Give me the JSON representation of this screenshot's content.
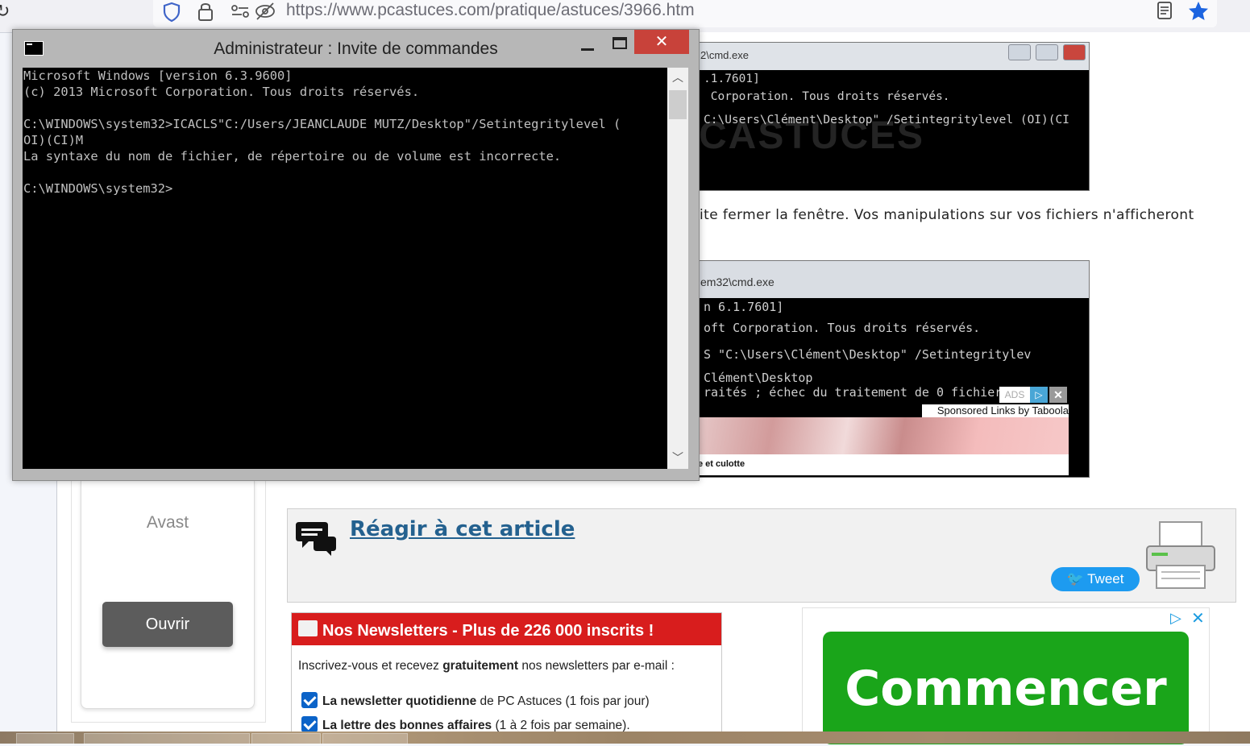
{
  "browser": {
    "url": "https://www.pcastuces.com/pratique/astuces/3966.htm"
  },
  "cmd_window": {
    "title": "Administrateur : Invite de commandes",
    "lines": [
      "Microsoft Windows [version 6.3.9600]",
      "(c) 2013 Microsoft Corporation. Tous droits réservés.",
      "",
      "C:\\WINDOWS\\system32>ICACLS\"C:/Users/JEANCLAUDE MUTZ/Desktop\"/Setintegritylevel (",
      "OI)(CI)M",
      "La syntaxe du nom de fichier, de répertoire ou de volume est incorrecte.",
      "",
      "C:\\WINDOWS\\system32>"
    ]
  },
  "article": {
    "screenshot1": {
      "title": "2\\cmd.exe",
      "lines": [
        ".1.7601]",
        " Corporation. Tous droits réservés.",
        "C:\\Users\\Clément\\Desktop\" /Setintegritylevel (OI)(CI"
      ],
      "watermark": "CASTUCES"
    },
    "paragraph": "ite fermer la fenêtre. Vos manipulations sur vos fichiers n'afficheront",
    "screenshot2": {
      "title": "em32\\cmd.exe",
      "lines": [
        "n 6.1.7601]",
        "oft Corporation. Tous droits réservés.",
        "S \"C:\\Users\\Clément\\Desktop\" /Setintegritylev",
        "Clément\\Desktop",
        "raités ; échec du traitement de 0 fichiers"
      ]
    },
    "ad_strip": {
      "ads_label": "ADS",
      "sponsored": "Sponsored Links by Taboola",
      "caption": "e et culotte"
    }
  },
  "left_card": {
    "name": "Avast",
    "button": "Ouvrir"
  },
  "react": {
    "title": "Réagir à cet article",
    "tweet": "Tweet"
  },
  "newsletter": {
    "header": "Nos Newsletters - Plus de 226 000 inscrits !",
    "intro_pre": "Inscrivez-vous et recevez ",
    "intro_bold": "gratuitement",
    "intro_post": " nos newsletters par e-mail :",
    "options": [
      {
        "bold": "La newsletter quotidienne",
        "rest": " de PC Astuces (1 fois par jour)"
      },
      {
        "bold": "La lettre des bonnes affaires",
        "rest": " (1 à 2 fois par semaine)."
      }
    ]
  },
  "right_ad": {
    "cta": "Commencer"
  },
  "colors": {
    "link": "#24618f",
    "newsletter_red": "#d81d1d",
    "cta_green": "#1aa51a",
    "tweet_blue": "#1d9bf0",
    "close_red": "#c8423a"
  }
}
